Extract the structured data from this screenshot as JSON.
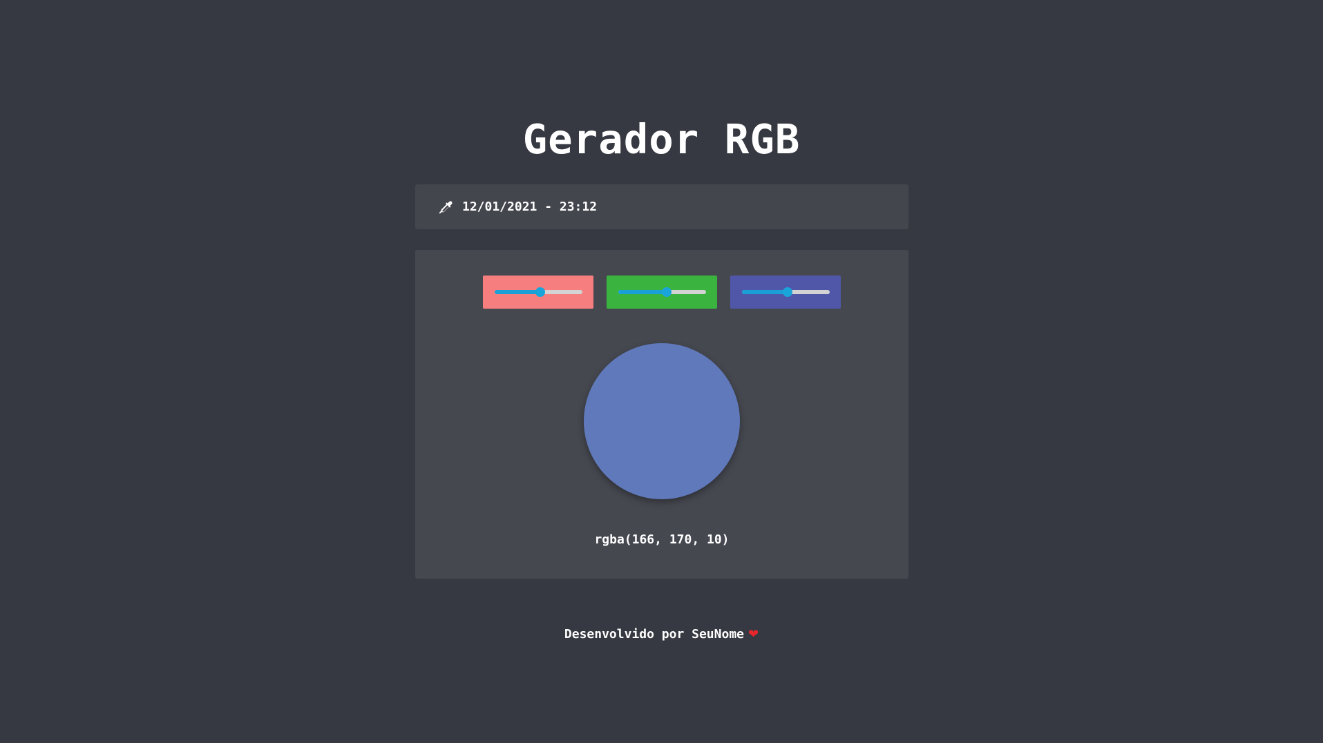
{
  "header": {
    "title": "Gerador RGB"
  },
  "date_bar": {
    "icon": "eyedropper-icon",
    "text": "12/01/2021 - 23:12"
  },
  "sliders": {
    "red": {
      "value_fraction": 0.52,
      "bg_color": "#f67e7f"
    },
    "green": {
      "value_fraction": 0.55,
      "bg_color": "#3bb33f"
    },
    "blue": {
      "value_fraction": 0.52,
      "bg_color": "#5057a9"
    }
  },
  "preview": {
    "color": "#6079bb",
    "rgba_text": "rgba(166, 170, 10)"
  },
  "footer": {
    "text": "Desenvolvido por SeuNome",
    "icon": "heart-icon",
    "heart": "❤"
  }
}
